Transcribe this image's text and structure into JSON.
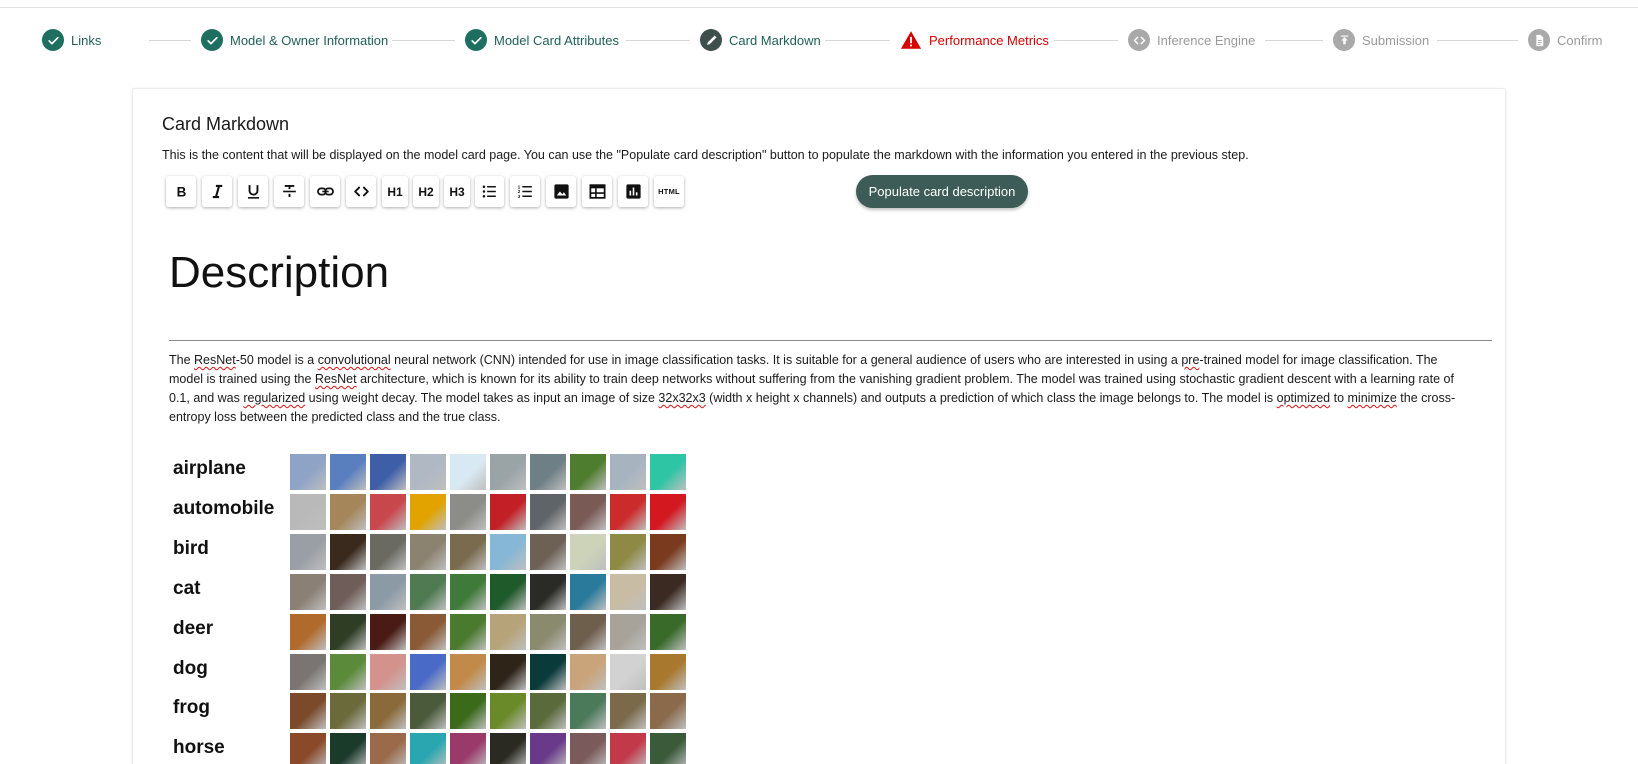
{
  "stepper": [
    {
      "label": "Links",
      "state": "done",
      "icon": "check-icon"
    },
    {
      "label": "Model & Owner Information",
      "state": "done",
      "icon": "check-icon"
    },
    {
      "label": "Model Card Attributes",
      "state": "done",
      "icon": "check-icon"
    },
    {
      "label": "Card Markdown",
      "state": "edit",
      "icon": "pencil-icon"
    },
    {
      "label": "Performance Metrics",
      "state": "err",
      "icon": "warning-icon"
    },
    {
      "label": "Inference Engine",
      "state": "todo",
      "icon": "code-icon"
    },
    {
      "label": "Submission",
      "state": "todo",
      "icon": "upload-icon"
    },
    {
      "label": "Confirm",
      "state": "todo",
      "icon": "document-icon"
    }
  ],
  "colors": {
    "accent": "#1f6f60",
    "error": "#d50000",
    "populate_button": "#3d5c57",
    "inactive": "#a9a9a9"
  },
  "card": {
    "title": "Card Markdown",
    "help": "This is the content that will be displayed on the model card page. You can use the \"Populate card description\" button to populate the markdown with the information you entered in the previous step."
  },
  "toolbar": {
    "buttons": [
      {
        "name": "bold",
        "text": "",
        "icon": "bold-icon"
      },
      {
        "name": "italic",
        "text": "",
        "icon": "italic-icon"
      },
      {
        "name": "underline",
        "text": "",
        "icon": "underline-icon"
      },
      {
        "name": "strikethrough",
        "text": "",
        "icon": "strikethrough-icon"
      },
      {
        "name": "link",
        "text": "",
        "icon": "link-icon"
      },
      {
        "name": "code",
        "text": "",
        "icon": "code-icon"
      },
      {
        "name": "h1",
        "text": "H1",
        "icon": ""
      },
      {
        "name": "h2",
        "text": "H2",
        "icon": ""
      },
      {
        "name": "h3",
        "text": "H3",
        "icon": ""
      },
      {
        "name": "bullet-list",
        "text": "",
        "icon": "bullet-list-icon"
      },
      {
        "name": "numbered-list",
        "text": "",
        "icon": "numbered-list-icon"
      },
      {
        "name": "image",
        "text": "",
        "icon": "image-icon"
      },
      {
        "name": "table",
        "text": "",
        "icon": "table-icon"
      },
      {
        "name": "chart",
        "text": "",
        "icon": "chart-icon"
      },
      {
        "name": "html",
        "text": "HTML",
        "icon": ""
      }
    ],
    "populate_label": "Populate card description"
  },
  "markdown": {
    "heading": "Description",
    "paragraph": [
      {
        "t": "The ",
        "spell": false
      },
      {
        "t": "ResNet",
        "spell": true
      },
      {
        "t": "-50 model is a ",
        "spell": false
      },
      {
        "t": "convolutional",
        "spell": true
      },
      {
        "t": " neural network (CNN) intended for use in image classification tasks. It is suitable for a general audience of users who are interested in using a ",
        "spell": false
      },
      {
        "t": "pre",
        "spell": true
      },
      {
        "t": "-trained model for image classification. The model is trained using the ",
        "spell": false
      },
      {
        "t": "ResNet",
        "spell": true
      },
      {
        "t": " architecture, which is known for its ability to train deep networks without suffering from the vanishing gradient problem. The model was trained using stochastic gradient descent with a learning rate of 0.1, and was ",
        "spell": false
      },
      {
        "t": "regularized",
        "spell": true
      },
      {
        "t": " using weight decay. The model takes as input an image of size ",
        "spell": false
      },
      {
        "t": "32x32x3",
        "spell": true
      },
      {
        "t": " (width x height x channels) and outputs a prediction of which class the image belongs to. The model is ",
        "spell": false
      },
      {
        "t": "optimized",
        "spell": true
      },
      {
        "t": " to ",
        "spell": false
      },
      {
        "t": "minimize",
        "spell": true
      },
      {
        "t": " the cross-entropy loss between the predicted class and the true class.",
        "spell": false
      }
    ],
    "image_classes": [
      "airplane",
      "automobile",
      "bird",
      "cat",
      "deer",
      "dog",
      "frog",
      "horse"
    ],
    "thumbnail_palettes": {
      "airplane": [
        "#8ea3c6",
        "#5a7fbf",
        "#3e5fa8",
        "#b0b8c4",
        "#d9e9f3",
        "#9aa3a6",
        "#6e7f86",
        "#4f7d2f",
        "#a7b4c0",
        "#2ec5a5"
      ],
      "automobile": [
        "#b9b9b9",
        "#a4865a",
        "#c8474d",
        "#e2a300",
        "#8c8c88",
        "#c21f26",
        "#5f6468",
        "#7a5a55",
        "#cc2b2b",
        "#d41820"
      ],
      "bird": [
        "#9a9fa6",
        "#3a2a1e",
        "#6a6a62",
        "#8c8270",
        "#7b6b4e",
        "#86b7d6",
        "#6d6156",
        "#ccd3b9",
        "#8e8a45",
        "#7a3a1e"
      ],
      "cat": [
        "#8b8075",
        "#6e5d58",
        "#8c9aa5",
        "#4f7a52",
        "#3f7a3a",
        "#1f5a2a",
        "#2a2a26",
        "#2a7a9c",
        "#c9bca4",
        "#3a2a22"
      ],
      "deer": [
        "#b06a2c",
        "#2f3d24",
        "#4a1a14",
        "#8a5a36",
        "#4a7a2e",
        "#b7a37a",
        "#8a8a6e",
        "#6e5e4c",
        "#a7a39a",
        "#3a6a2a"
      ],
      "dog": [
        "#7a7572",
        "#5a8a3a",
        "#d4928c",
        "#4a6ac8",
        "#c28a4a",
        "#2e2418",
        "#0a3a3a",
        "#c9a47a",
        "#d2d2d2",
        "#a8782e"
      ],
      "frog": [
        "#7a4a2a",
        "#6a6a3a",
        "#8a6a3a",
        "#4a5a3a",
        "#3a6a1a",
        "#6a8a2a",
        "#5a6a3a",
        "#4a7a5a",
        "#7a6a4a",
        "#8a6a4a"
      ],
      "horse": [
        "#8a4a2a",
        "#1a3a2a",
        "#9a6a4a",
        "#2aa6b0",
        "#9a3a6a",
        "#2a2a22",
        "#6a3a8a",
        "#7a5a5a",
        "#c23a4a",
        "#3a5a3a"
      ]
    }
  }
}
